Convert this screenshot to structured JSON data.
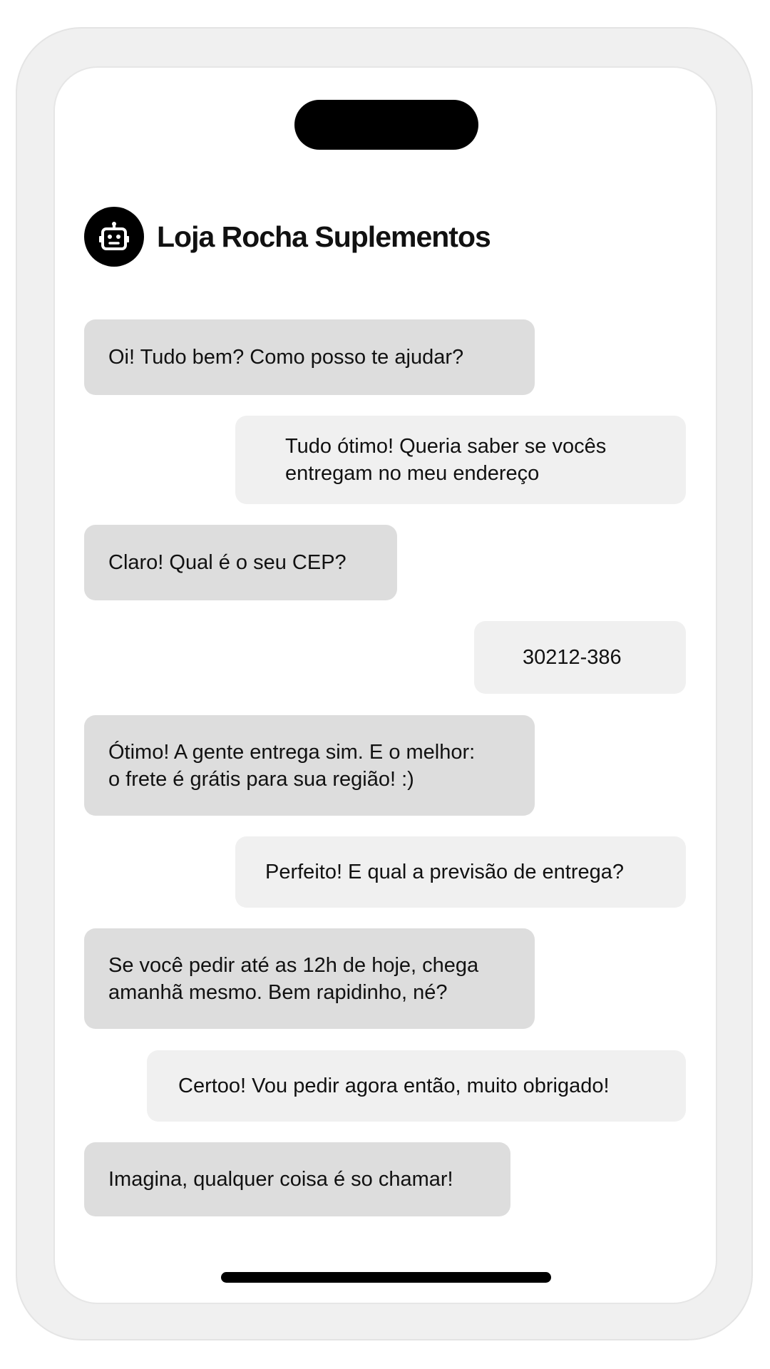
{
  "app": {
    "title": "Loja Rocha Suplementos",
    "avatar_icon": "robot-icon"
  },
  "messages": [
    {
      "sender": "bot",
      "text": "Oi! Tudo bem? Como posso te ajudar?"
    },
    {
      "sender": "user",
      "text": "Tudo ótimo! Queria saber se vocês\nentregam no meu endereço"
    },
    {
      "sender": "bot",
      "text": "Claro! Qual é o seu CEP?"
    },
    {
      "sender": "user",
      "text": "30212-386"
    },
    {
      "sender": "bot",
      "text": "Ótimo! A gente entrega sim. E o melhor:\no frete é grátis para sua região! :)"
    },
    {
      "sender": "user",
      "text": "Perfeito! E qual a previsão de entrega?"
    },
    {
      "sender": "bot",
      "text": "Se você pedir até as 12h de hoje, chega\namanhã mesmo. Bem rapidinho, né?"
    },
    {
      "sender": "user",
      "text": "Certoo! Vou pedir agora então, muito obrigado!"
    },
    {
      "sender": "bot",
      "text": "Imagina, qualquer coisa é so chamar!"
    }
  ],
  "colors": {
    "bot_bubble": "#dddddd",
    "user_bubble": "#f0f0f0",
    "frame": "#f0f0f0",
    "text": "#111111"
  }
}
